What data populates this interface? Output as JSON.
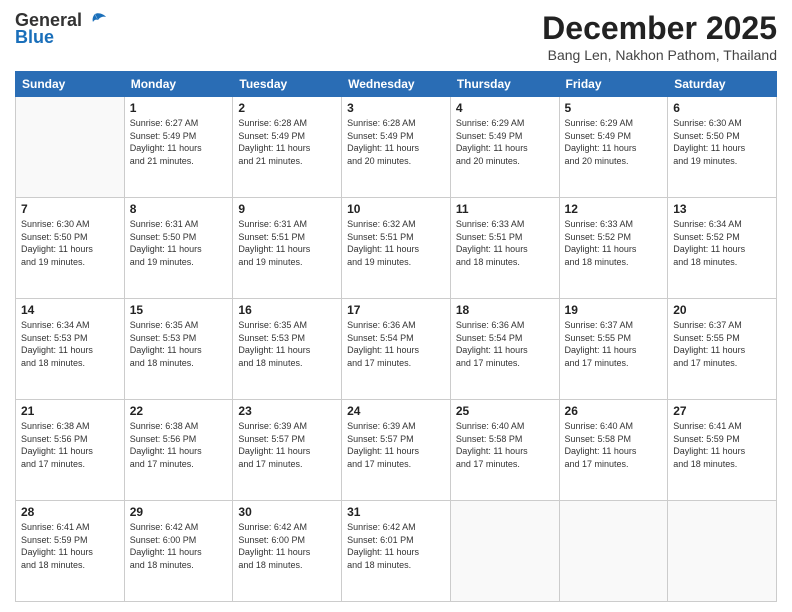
{
  "header": {
    "logo_general": "General",
    "logo_blue": "Blue",
    "month_title": "December 2025",
    "location": "Bang Len, Nakhon Pathom, Thailand"
  },
  "days_of_week": [
    "Sunday",
    "Monday",
    "Tuesday",
    "Wednesday",
    "Thursday",
    "Friday",
    "Saturday"
  ],
  "weeks": [
    [
      {
        "day": "",
        "info": ""
      },
      {
        "day": "1",
        "info": "Sunrise: 6:27 AM\nSunset: 5:49 PM\nDaylight: 11 hours\nand 21 minutes."
      },
      {
        "day": "2",
        "info": "Sunrise: 6:28 AM\nSunset: 5:49 PM\nDaylight: 11 hours\nand 21 minutes."
      },
      {
        "day": "3",
        "info": "Sunrise: 6:28 AM\nSunset: 5:49 PM\nDaylight: 11 hours\nand 20 minutes."
      },
      {
        "day": "4",
        "info": "Sunrise: 6:29 AM\nSunset: 5:49 PM\nDaylight: 11 hours\nand 20 minutes."
      },
      {
        "day": "5",
        "info": "Sunrise: 6:29 AM\nSunset: 5:49 PM\nDaylight: 11 hours\nand 20 minutes."
      },
      {
        "day": "6",
        "info": "Sunrise: 6:30 AM\nSunset: 5:50 PM\nDaylight: 11 hours\nand 19 minutes."
      }
    ],
    [
      {
        "day": "7",
        "info": "Sunrise: 6:30 AM\nSunset: 5:50 PM\nDaylight: 11 hours\nand 19 minutes."
      },
      {
        "day": "8",
        "info": "Sunrise: 6:31 AM\nSunset: 5:50 PM\nDaylight: 11 hours\nand 19 minutes."
      },
      {
        "day": "9",
        "info": "Sunrise: 6:31 AM\nSunset: 5:51 PM\nDaylight: 11 hours\nand 19 minutes."
      },
      {
        "day": "10",
        "info": "Sunrise: 6:32 AM\nSunset: 5:51 PM\nDaylight: 11 hours\nand 19 minutes."
      },
      {
        "day": "11",
        "info": "Sunrise: 6:33 AM\nSunset: 5:51 PM\nDaylight: 11 hours\nand 18 minutes."
      },
      {
        "day": "12",
        "info": "Sunrise: 6:33 AM\nSunset: 5:52 PM\nDaylight: 11 hours\nand 18 minutes."
      },
      {
        "day": "13",
        "info": "Sunrise: 6:34 AM\nSunset: 5:52 PM\nDaylight: 11 hours\nand 18 minutes."
      }
    ],
    [
      {
        "day": "14",
        "info": "Sunrise: 6:34 AM\nSunset: 5:53 PM\nDaylight: 11 hours\nand 18 minutes."
      },
      {
        "day": "15",
        "info": "Sunrise: 6:35 AM\nSunset: 5:53 PM\nDaylight: 11 hours\nand 18 minutes."
      },
      {
        "day": "16",
        "info": "Sunrise: 6:35 AM\nSunset: 5:53 PM\nDaylight: 11 hours\nand 18 minutes."
      },
      {
        "day": "17",
        "info": "Sunrise: 6:36 AM\nSunset: 5:54 PM\nDaylight: 11 hours\nand 17 minutes."
      },
      {
        "day": "18",
        "info": "Sunrise: 6:36 AM\nSunset: 5:54 PM\nDaylight: 11 hours\nand 17 minutes."
      },
      {
        "day": "19",
        "info": "Sunrise: 6:37 AM\nSunset: 5:55 PM\nDaylight: 11 hours\nand 17 minutes."
      },
      {
        "day": "20",
        "info": "Sunrise: 6:37 AM\nSunset: 5:55 PM\nDaylight: 11 hours\nand 17 minutes."
      }
    ],
    [
      {
        "day": "21",
        "info": "Sunrise: 6:38 AM\nSunset: 5:56 PM\nDaylight: 11 hours\nand 17 minutes."
      },
      {
        "day": "22",
        "info": "Sunrise: 6:38 AM\nSunset: 5:56 PM\nDaylight: 11 hours\nand 17 minutes."
      },
      {
        "day": "23",
        "info": "Sunrise: 6:39 AM\nSunset: 5:57 PM\nDaylight: 11 hours\nand 17 minutes."
      },
      {
        "day": "24",
        "info": "Sunrise: 6:39 AM\nSunset: 5:57 PM\nDaylight: 11 hours\nand 17 minutes."
      },
      {
        "day": "25",
        "info": "Sunrise: 6:40 AM\nSunset: 5:58 PM\nDaylight: 11 hours\nand 17 minutes."
      },
      {
        "day": "26",
        "info": "Sunrise: 6:40 AM\nSunset: 5:58 PM\nDaylight: 11 hours\nand 17 minutes."
      },
      {
        "day": "27",
        "info": "Sunrise: 6:41 AM\nSunset: 5:59 PM\nDaylight: 11 hours\nand 18 minutes."
      }
    ],
    [
      {
        "day": "28",
        "info": "Sunrise: 6:41 AM\nSunset: 5:59 PM\nDaylight: 11 hours\nand 18 minutes."
      },
      {
        "day": "29",
        "info": "Sunrise: 6:42 AM\nSunset: 6:00 PM\nDaylight: 11 hours\nand 18 minutes."
      },
      {
        "day": "30",
        "info": "Sunrise: 6:42 AM\nSunset: 6:00 PM\nDaylight: 11 hours\nand 18 minutes."
      },
      {
        "day": "31",
        "info": "Sunrise: 6:42 AM\nSunset: 6:01 PM\nDaylight: 11 hours\nand 18 minutes."
      },
      {
        "day": "",
        "info": ""
      },
      {
        "day": "",
        "info": ""
      },
      {
        "day": "",
        "info": ""
      }
    ]
  ]
}
